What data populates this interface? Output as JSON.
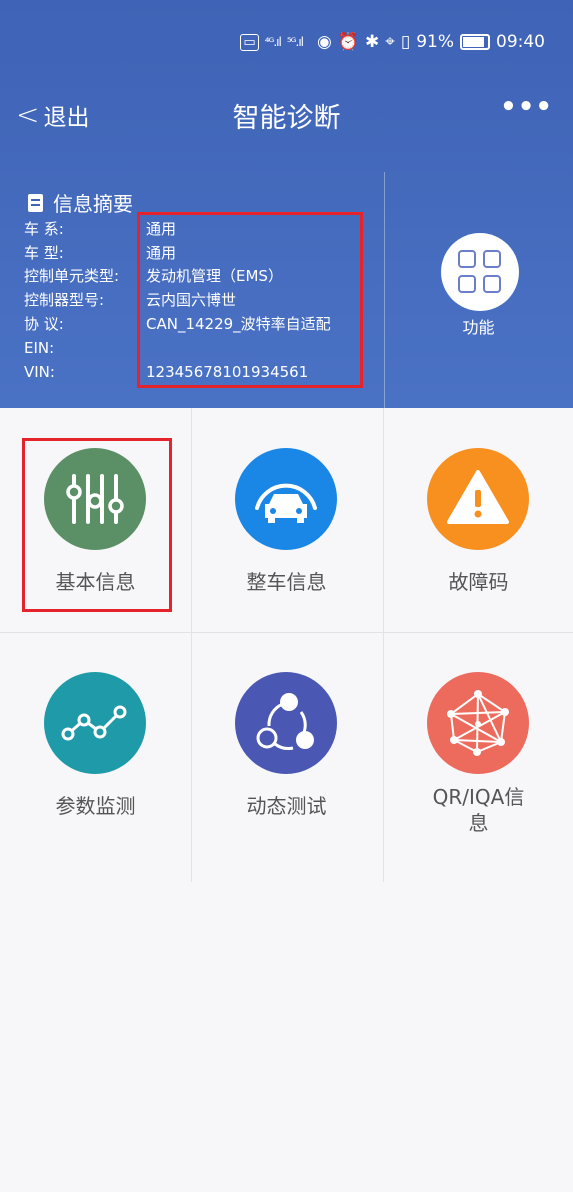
{
  "status_bar": {
    "signal_1": "⁴ᴳ.ıl",
    "signal_2": "⁵ᴳ.ıl",
    "battery": "91%",
    "time": "09:40"
  },
  "header": {
    "back_label": "退出",
    "title": "智能诊断",
    "more": "•••"
  },
  "info": {
    "title": "信息摘要",
    "rows": [
      {
        "label": "车 系:",
        "value": "通用"
      },
      {
        "label": "车 型:",
        "value": "通用"
      },
      {
        "label": "控制单元类型:",
        "value": "发动机管理（EMS）"
      },
      {
        "label": "控制器型号:",
        "value": "云内国六博世"
      },
      {
        "label": "协 议:",
        "value": "CAN_14229_波特率自适配"
      },
      {
        "label": "EIN:",
        "value": ""
      },
      {
        "label": "VIN:",
        "value": "12345678101934561"
      }
    ]
  },
  "function_button": {
    "label": "功能"
  },
  "tiles": [
    {
      "label": "基本信息",
      "icon": "sliders-icon",
      "color": "#5b8f66"
    },
    {
      "label": "整车信息",
      "icon": "car-icon",
      "color": "#1a86e6"
    },
    {
      "label": "故障码",
      "icon": "warning-icon",
      "color": "#f7901e"
    },
    {
      "label": "参数监测",
      "icon": "line-chart-icon",
      "color": "#1f9aa8"
    },
    {
      "label": "动态测试",
      "icon": "share-nodes-icon",
      "color": "#4a58b3"
    },
    {
      "label": "QR/IQA信息",
      "icon": "network-icon",
      "color": "#ec6b5d"
    }
  ],
  "highlight_color": "#e4232a"
}
